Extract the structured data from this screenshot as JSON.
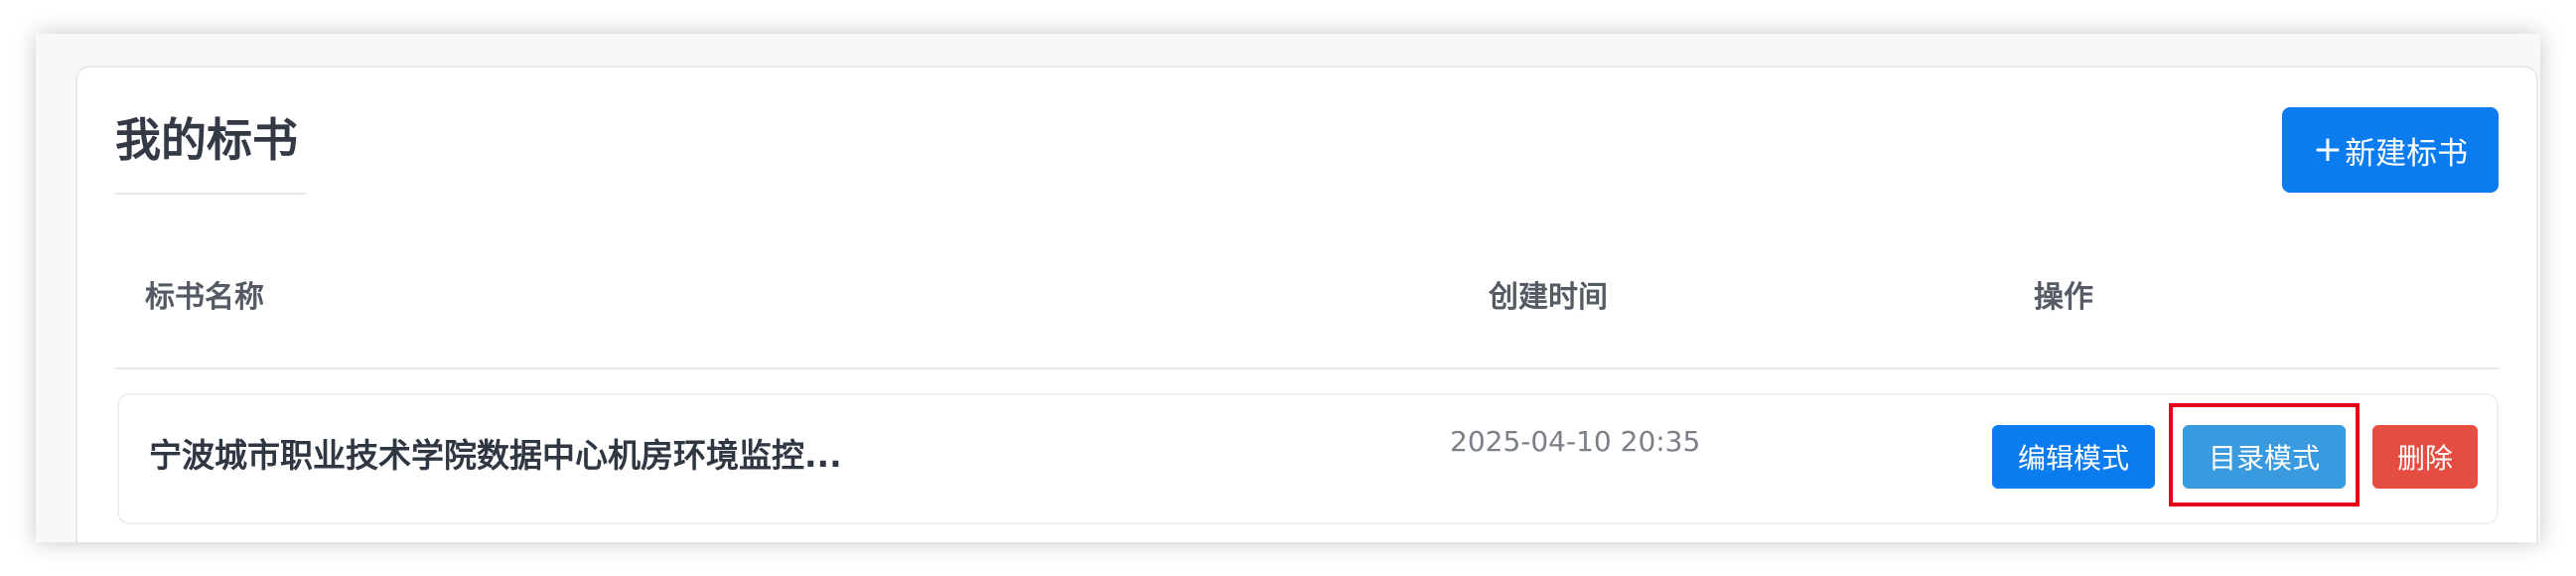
{
  "header": {
    "title": "我的标书",
    "new_button_plus": "+",
    "new_button_label": "新建标书"
  },
  "table": {
    "columns": [
      "标书名称",
      "创建时间",
      "操作"
    ],
    "rows": [
      {
        "name": "宁波城市职业技术学院数据中心机房环境监控...",
        "created": "2025-04-10 20:35",
        "actions": {
          "edit": "编辑模式",
          "toc": "目录模式",
          "delete": "删除"
        }
      }
    ]
  },
  "colors": {
    "primary": "#0a7cf0",
    "secondary": "#3a9ae0",
    "danger": "#e54d42",
    "highlight_box": "#e4001b"
  }
}
